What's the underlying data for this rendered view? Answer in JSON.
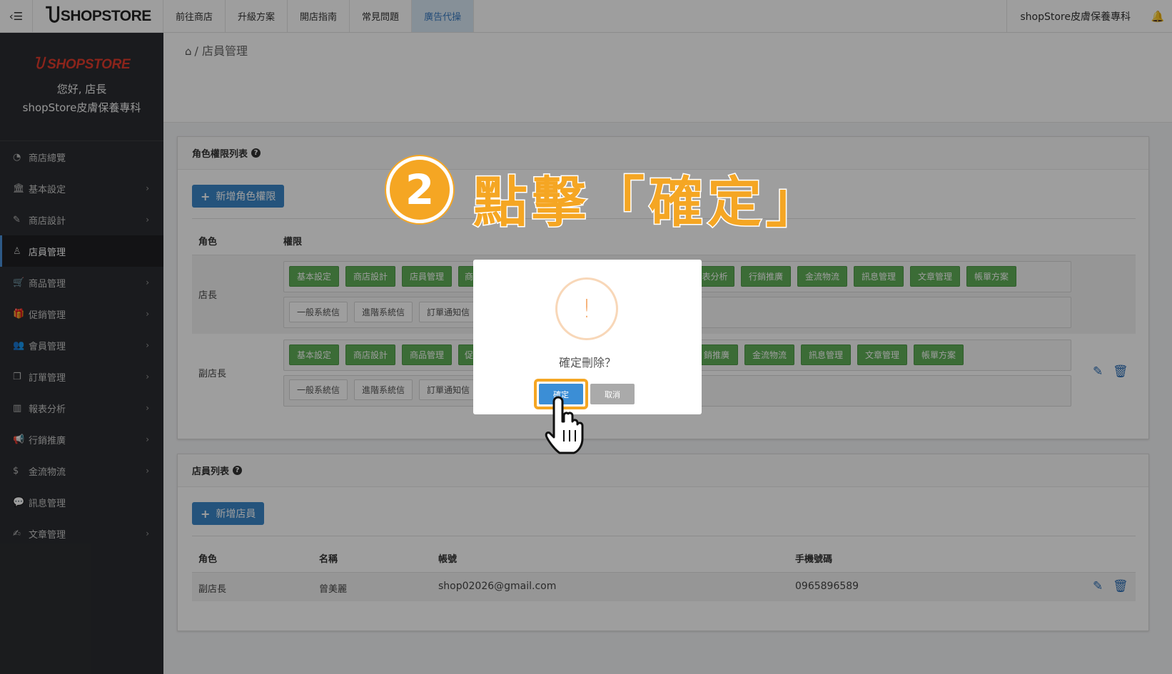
{
  "topbar": {
    "toggle_icon": "‹☰",
    "logo_text": "SHOPSTORE",
    "nav": [
      "前往商店",
      "升級方案",
      "開店指南",
      "常見問題",
      "廣告代操"
    ],
    "shop_name": "shopStore皮膚保養專科",
    "bell_icon": "🔔"
  },
  "sidebar": {
    "logo_text": "SHOPSTORE",
    "greeting": "您好, 店長",
    "shop_name": "shopStore皮膚保養專科",
    "items": [
      {
        "label": "商店總覽",
        "icon": "◔"
      },
      {
        "label": "基本設定",
        "icon": "🏛"
      },
      {
        "label": "商店設計",
        "icon": "✎"
      },
      {
        "label": "店員管理",
        "icon": "♙"
      },
      {
        "label": "商品管理",
        "icon": "🛒"
      },
      {
        "label": "促銷管理",
        "icon": "🎁"
      },
      {
        "label": "會員管理",
        "icon": "👥"
      },
      {
        "label": "訂單管理",
        "icon": "❐"
      },
      {
        "label": "報表分析",
        "icon": "▥"
      },
      {
        "label": "行銷推廣",
        "icon": "📢"
      },
      {
        "label": "金流物流",
        "icon": "$"
      },
      {
        "label": "訊息管理",
        "icon": "💬"
      },
      {
        "label": "文章管理",
        "icon": "✍"
      }
    ]
  },
  "breadcrumb": {
    "current": "店員管理"
  },
  "role_panel": {
    "title": "角色權限列表",
    "add_button": "新增角色權限",
    "col_role": "角色",
    "col_perm": "權限",
    "rows": [
      {
        "role": "店長",
        "green_tags": [
          "基本設定",
          "商店設計",
          "店員管理",
          "商",
          "表分析",
          "行銷推廣",
          "金流物流",
          "訊息管理",
          "文章管理",
          "帳單方案"
        ],
        "gray_tags": [
          "一般系統信",
          "進階系統信",
          "訂單通知信"
        ]
      },
      {
        "role": "副店長",
        "green_tags": [
          "基本設定",
          "商店設計",
          "商品管理",
          "促",
          "銷推廣",
          "金流物流",
          "訊息管理",
          "文章管理",
          "帳單方案"
        ],
        "gray_tags": [
          "一般系統信",
          "進階系統信",
          "訂單通知信"
        ]
      }
    ]
  },
  "staff_panel": {
    "title": "店員列表",
    "add_button": "新增店員",
    "columns": [
      "角色",
      "名稱",
      "帳號",
      "手機號碼"
    ],
    "rows": [
      {
        "role": "副店長",
        "name": "曾美麗",
        "account": "shop02026@gmail.com",
        "phone": "0965896589"
      }
    ]
  },
  "modal": {
    "icon": "!",
    "title": "確定刪除？",
    "confirm": "確定",
    "cancel": "取消"
  },
  "annotation": {
    "step": "2",
    "text": "點擊「確定」",
    "accent_color": "#f5a623"
  }
}
